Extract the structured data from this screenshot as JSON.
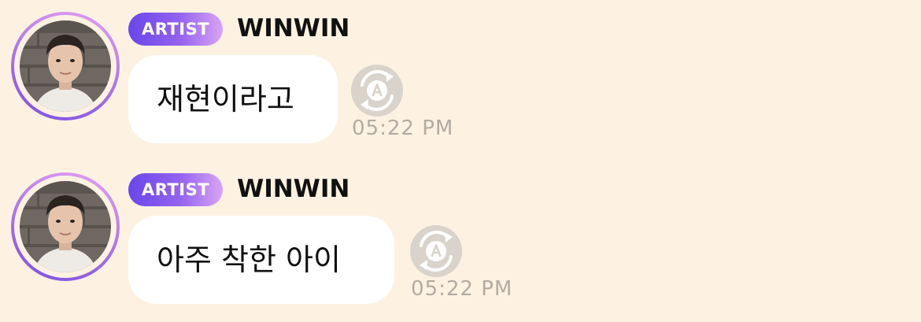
{
  "colors": {
    "background": "#fdf2e2",
    "bubble": "#ffffff",
    "badge_start": "#6a46ea",
    "badge_end": "#d9a4f3",
    "timestamp": "#b3aba2",
    "translate_button": "#d9d3cb"
  },
  "messages": [
    {
      "badge": "ARTIST",
      "sender": "WINWIN",
      "text": "재현이라고",
      "time": "05:22 PM",
      "translate_icon": "translate-a-icon"
    },
    {
      "badge": "ARTIST",
      "sender": "WINWIN",
      "text": "아주 착한 아이",
      "time": "05:22 PM",
      "translate_icon": "translate-a-icon"
    }
  ]
}
